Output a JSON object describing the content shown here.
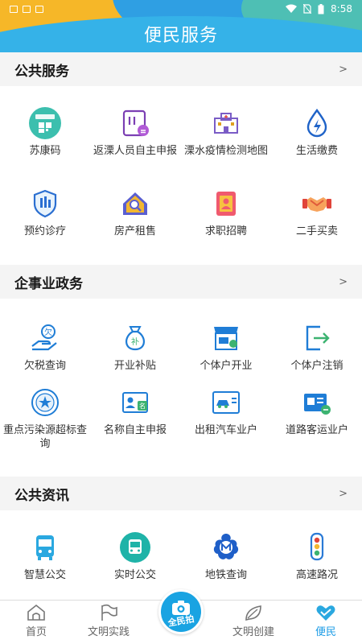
{
  "status": {
    "time": "8:58"
  },
  "header": {
    "title": "便民服务"
  },
  "sections": [
    {
      "title": "公共服务",
      "more": ">",
      "items": [
        {
          "label": "苏康码",
          "icon": "sukang-code-icon"
        },
        {
          "label": "返溧人员自主申报",
          "icon": "declaration-icon"
        },
        {
          "label": "溧水疫情检测地图",
          "icon": "hospital-map-icon"
        },
        {
          "label": "生活缴费",
          "icon": "utility-payment-icon"
        },
        {
          "label": "预约诊疗",
          "icon": "clinic-booking-icon"
        },
        {
          "label": "房产租售",
          "icon": "house-search-icon"
        },
        {
          "label": "求职招聘",
          "icon": "job-profile-icon"
        },
        {
          "label": "二手买卖",
          "icon": "handshake-icon"
        }
      ]
    },
    {
      "title": "企事业政务",
      "more": ">",
      "items": [
        {
          "label": "欠税查询",
          "icon": "tax-query-icon"
        },
        {
          "label": "开业补贴",
          "icon": "subsidy-bag-icon"
        },
        {
          "label": "个体户开业",
          "icon": "shop-open-icon"
        },
        {
          "label": "个体户注销",
          "icon": "shop-cancel-icon"
        },
        {
          "label": "重点污染源超标查询",
          "icon": "pollution-seal-icon"
        },
        {
          "label": "名称自主申报",
          "icon": "name-declare-icon"
        },
        {
          "label": "出租汽车业户",
          "icon": "taxi-license-icon"
        },
        {
          "label": "道路客运业户",
          "icon": "road-transport-icon"
        }
      ]
    },
    {
      "title": "公共资讯",
      "more": ">",
      "items": [
        {
          "label": "智慧公交",
          "icon": "bus-icon"
        },
        {
          "label": "实时公交",
          "icon": "realtime-bus-icon"
        },
        {
          "label": "地铁查询",
          "icon": "metro-icon"
        },
        {
          "label": "高速路况",
          "icon": "traffic-light-icon"
        }
      ]
    }
  ],
  "tabbar": {
    "tabs": [
      {
        "label": "首页",
        "icon": "home-icon"
      },
      {
        "label": "文明实践",
        "icon": "flag-icon"
      },
      {
        "label": "文明创建",
        "icon": "leaf-icon"
      },
      {
        "label": "便民",
        "icon": "heart-icon",
        "active": true
      }
    ],
    "center": {
      "label": "全民拍",
      "icon": "camera-icon"
    }
  },
  "colors": {
    "accent": "#1a9be6",
    "header": "#3aa7e6",
    "header_yellow": "#f6b728"
  }
}
